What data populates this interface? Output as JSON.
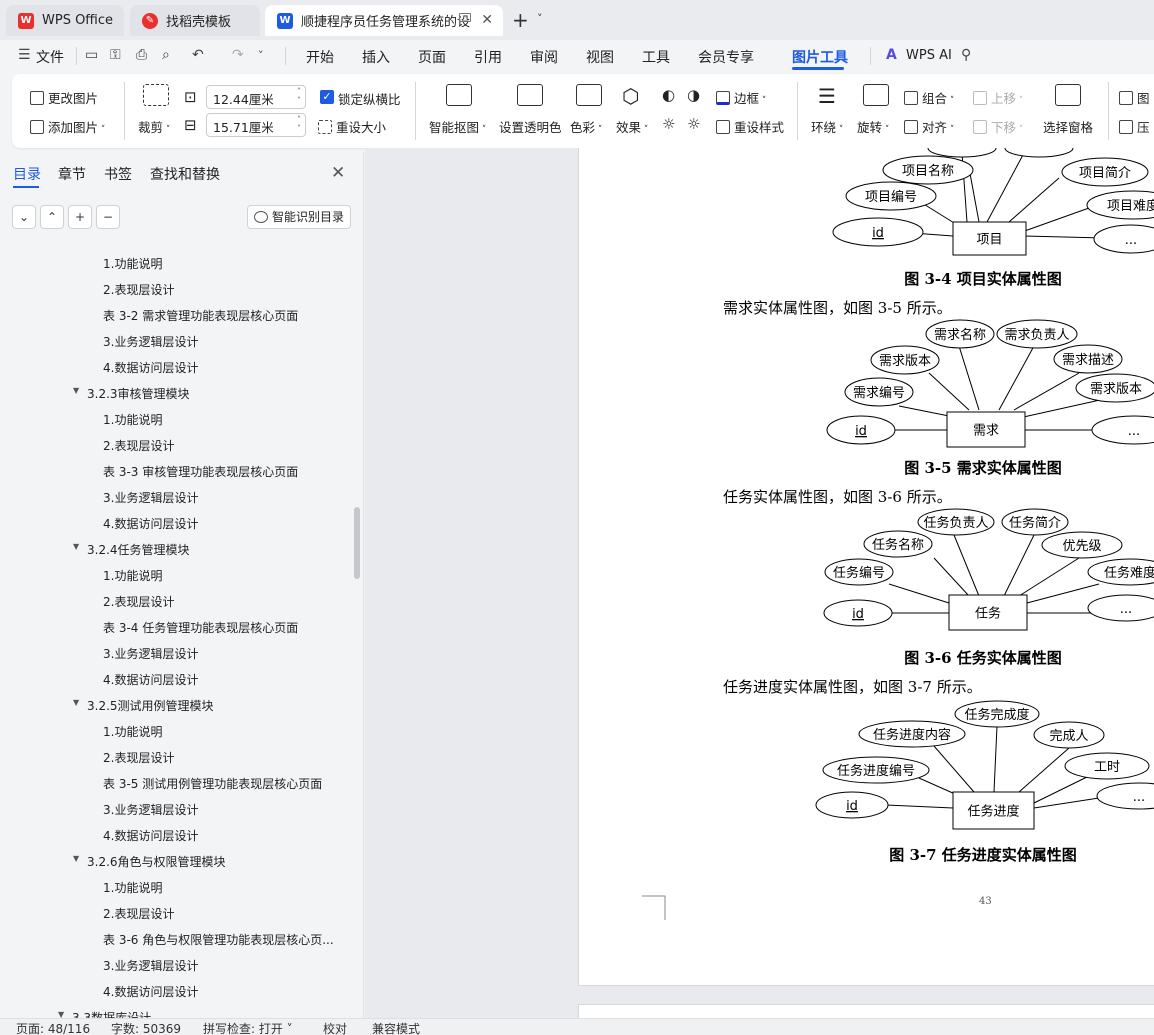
{
  "tabs": [
    {
      "label": "WPS Office",
      "icon": "wps-logo-icon"
    },
    {
      "label": "找稻壳模板",
      "icon": "docer-icon"
    },
    {
      "label": "顺捷程序员任务管理系统的设",
      "icon": "word-doc-icon"
    }
  ],
  "menu": {
    "file": "文件",
    "items": [
      "开始",
      "插入",
      "页面",
      "引用",
      "审阅",
      "视图",
      "工具",
      "会员专享",
      "图片工具"
    ],
    "wps_ai": "WPS AI"
  },
  "ribbon": {
    "change_picture": "更改图片",
    "add_picture": "添加图片",
    "crop": "裁剪",
    "width_value": "12.44厘米",
    "height_value": "15.71厘米",
    "lock_ratio": "锁定纵横比",
    "reset_size": "重设大小",
    "smart_cutout": "智能抠图",
    "set_transparent": "设置透明色",
    "color": "色彩",
    "effect": "效果",
    "border": "边框",
    "reset_style": "重设样式",
    "wrap": "环绕",
    "rotate": "旋转",
    "group": "组合",
    "align": "对齐",
    "move_up": "上移",
    "move_down": "下移",
    "selection_pane": "选择窗格",
    "more1": "图",
    "more2": "压"
  },
  "nav": {
    "tabs": [
      "目录",
      "章节",
      "书签",
      "查找和替换"
    ],
    "smart_toc": "智能识别目录",
    "items": [
      {
        "text": "1.功能说明",
        "level": 4,
        "arrow": false
      },
      {
        "text": "2.表现层设计",
        "level": 4,
        "arrow": false
      },
      {
        "text": "表 3-2 需求管理功能表现层核心页面",
        "level": 4,
        "arrow": false
      },
      {
        "text": "3.业务逻辑层设计",
        "level": 4,
        "arrow": false
      },
      {
        "text": "4.数据访问层设计",
        "level": 4,
        "arrow": false
      },
      {
        "text": "3.2.3审核管理模块",
        "level": 3,
        "arrow": true
      },
      {
        "text": "1.功能说明",
        "level": 4,
        "arrow": false
      },
      {
        "text": "2.表现层设计",
        "level": 4,
        "arrow": false
      },
      {
        "text": "表 3-3 审核管理功能表现层核心页面",
        "level": 4,
        "arrow": false
      },
      {
        "text": "3.业务逻辑层设计",
        "level": 4,
        "arrow": false
      },
      {
        "text": "4.数据访问层设计",
        "level": 4,
        "arrow": false
      },
      {
        "text": "3.2.4任务管理模块",
        "level": 3,
        "arrow": true
      },
      {
        "text": "1.功能说明",
        "level": 4,
        "arrow": false
      },
      {
        "text": "2.表现层设计",
        "level": 4,
        "arrow": false
      },
      {
        "text": "表 3-4 任务管理功能表现层核心页面",
        "level": 4,
        "arrow": false
      },
      {
        "text": "3.业务逻辑层设计",
        "level": 4,
        "arrow": false
      },
      {
        "text": "4.数据访问层设计",
        "level": 4,
        "arrow": false
      },
      {
        "text": "3.2.5测试用例管理模块",
        "level": 3,
        "arrow": true
      },
      {
        "text": "1.功能说明",
        "level": 4,
        "arrow": false
      },
      {
        "text": "2.表现层设计",
        "level": 4,
        "arrow": false
      },
      {
        "text": "表 3-5 测试用例管理功能表现层核心页面",
        "level": 4,
        "arrow": false
      },
      {
        "text": "3.业务逻辑层设计",
        "level": 4,
        "arrow": false
      },
      {
        "text": "4.数据访问层设计",
        "level": 4,
        "arrow": false
      },
      {
        "text": "3.2.6角色与权限管理模块",
        "level": 3,
        "arrow": true
      },
      {
        "text": "1.功能说明",
        "level": 4,
        "arrow": false
      },
      {
        "text": "2.表现层设计",
        "level": 4,
        "arrow": false
      },
      {
        "text": "表 3-6 角色与权限管理功能表现层核心页...",
        "level": 4,
        "arrow": false
      },
      {
        "text": "3.业务逻辑层设计",
        "level": 4,
        "arrow": false
      },
      {
        "text": "4.数据访问层设计",
        "level": 4,
        "arrow": false
      },
      {
        "text": "3.3数据库设计",
        "level": 2,
        "arrow": true
      }
    ]
  },
  "document": {
    "fig34": {
      "caption": "图 3-4 项目实体属性图",
      "entity": "项目",
      "attrs": [
        "项目名称",
        "项目简介",
        "项目编号",
        "项目难度",
        "id",
        "..."
      ]
    },
    "para35": "需求实体属性图，如图 3-5 所示。",
    "fig35": {
      "caption": "图 3-5 需求实体属性图",
      "entity": "需求",
      "attrs": [
        "需求名称",
        "需求负责人",
        "需求版本",
        "需求描述",
        "需求编号",
        "需求版本",
        "id",
        "..."
      ]
    },
    "para36": "任务实体属性图，如图 3-6 所示。",
    "fig36": {
      "caption": "图 3-6 任务实体属性图",
      "entity": "任务",
      "attrs": [
        "任务负责人",
        "任务简介",
        "任务名称",
        "优先级",
        "任务编号",
        "任务难度",
        "id",
        "..."
      ]
    },
    "para37": "任务进度实体属性图，如图 3-7 所示。",
    "fig37": {
      "caption": "图 3-7 任务进度实体属性图",
      "entity": "任务进度",
      "attrs": [
        "任务完成度",
        "任务进度内容",
        "完成人",
        "任务进度编号",
        "工时",
        "id",
        "..."
      ]
    },
    "page_number": "43"
  },
  "status": {
    "page": "页面: 48/116",
    "words": "字数: 50369",
    "spell": "拼写检查: 打开",
    "proof": "校对",
    "compat": "兼容模式"
  },
  "colors": {
    "accent": "#1d5be0",
    "wps_red": "#e8312f"
  }
}
